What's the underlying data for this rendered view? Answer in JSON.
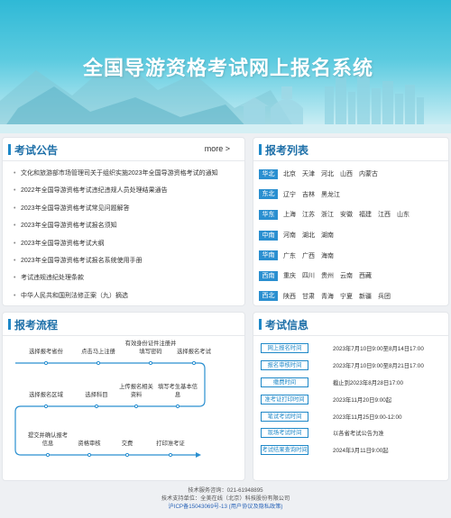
{
  "banner": {
    "title": "全国导游资格考试网上报名系统"
  },
  "news": {
    "title": "考试公告",
    "more": "more >",
    "items": [
      "文化和旅游部市场管理司关于组织实施2023年全国导游资格考试的通知",
      "2022年全国导游资格考试违纪违规人员处理结果通告",
      "2023年全国导游资格考试常见问题解答",
      "2023年全国导游资格考试报名须知",
      "2023年全国导游资格考试大纲",
      "2023年全国导游资格考试报名系统使用手册",
      "考试违规违纪处理条款",
      "中华人民共和国刑法修正案（九）摘选"
    ]
  },
  "regions": {
    "title": "报考列表",
    "rows": [
      {
        "tag": "华北",
        "provinces": [
          "北京",
          "天津",
          "河北",
          "山西",
          "内蒙古"
        ]
      },
      {
        "tag": "东北",
        "provinces": [
          "辽宁",
          "吉林",
          "黑龙江"
        ]
      },
      {
        "tag": "华东",
        "provinces": [
          "上海",
          "江苏",
          "浙江",
          "安徽",
          "福建",
          "江西",
          "山东"
        ]
      },
      {
        "tag": "中南",
        "provinces": [
          "河南",
          "湖北",
          "湖南"
        ]
      },
      {
        "tag": "华南",
        "provinces": [
          "广东",
          "广西",
          "海南"
        ]
      },
      {
        "tag": "西南",
        "provinces": [
          "重庆",
          "四川",
          "贵州",
          "云南",
          "西藏"
        ]
      },
      {
        "tag": "西北",
        "provinces": [
          "陕西",
          "甘肃",
          "青海",
          "宁夏",
          "新疆",
          "兵团"
        ]
      }
    ]
  },
  "flow": {
    "title": "报考流程",
    "steps": [
      "选择报考省份",
      "点击马上注册",
      "有效身份证件注册并填写密码",
      "选择报名考试",
      "选择报名区域",
      "选择科目",
      "上传报名相关资料",
      "填写考生基本信息",
      "提交并确认报考信息",
      "资格审核",
      "交费",
      "打印准考证"
    ]
  },
  "info": {
    "title": "考试信息",
    "rows": [
      {
        "label": "网上报名时间",
        "value": "2023年7月10日9:00至8月14日17:00"
      },
      {
        "label": "报名审核时间",
        "value": "2023年7月10日9:00至8月21日17:00"
      },
      {
        "label": "缴费时间",
        "value": "截止到2023年8月28日17:00"
      },
      {
        "label": "准考证打印时间",
        "value": "2023年11月20日9:00起"
      },
      {
        "label": "笔试考试时间",
        "value": "2023年11月25日9:00-12:00"
      },
      {
        "label": "现场考试时间",
        "value": "以各省考试公告为准"
      },
      {
        "label": "考试结果查询时间",
        "value": "2024年3月11日9:00起"
      }
    ]
  },
  "footer": {
    "hotline": "技术服务咨询：021-61948895",
    "support": "技术支持单位：全美在线（北京）科技股份有限公司",
    "icp": "沪ICP备15043069号-13",
    "privacy": "(用户协议及隐私政策)"
  }
}
